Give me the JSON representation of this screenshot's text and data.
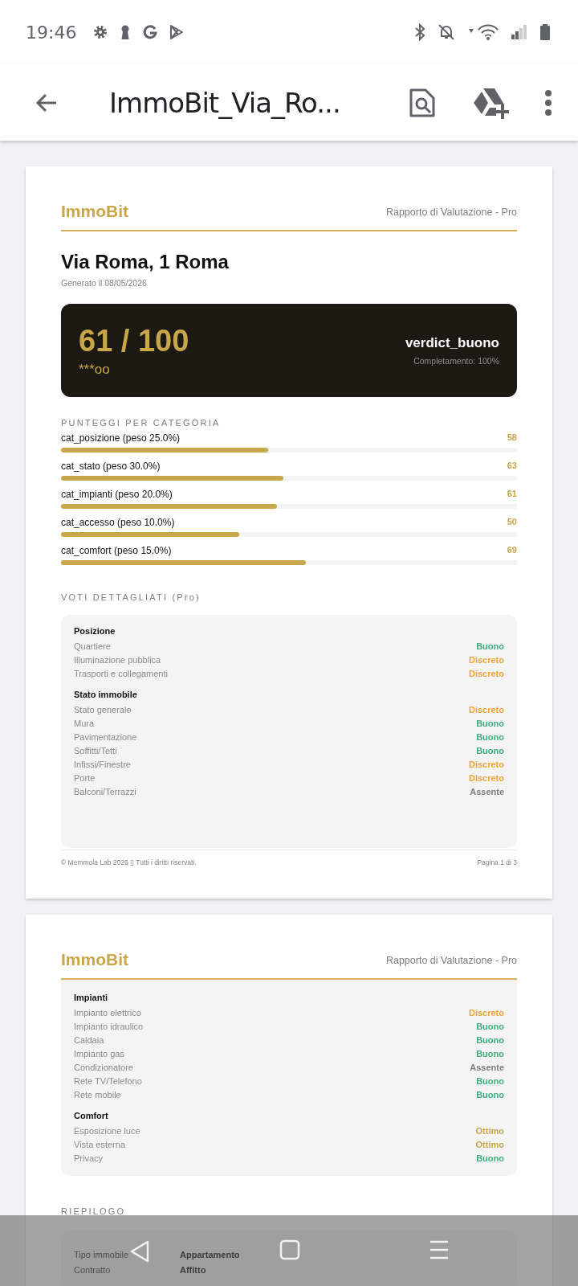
{
  "status_bar": {
    "time": "19:46"
  },
  "app_bar": {
    "title": "ImmoBit_Via_Ro..."
  },
  "pages": [
    {
      "brand": "ImmoBit",
      "report_type": "Rapporto di Valutazione - Pro",
      "address": "Via Roma, 1 Roma",
      "generated": "Generato il 08/05/2026",
      "score": {
        "value": "61 / 100",
        "stars_text": "***oo",
        "verdict": "verdict_buono",
        "completion": "Completamento: 100%"
      },
      "categories_title": "PUNTEGGI PER CATEGORIA",
      "categories": [
        {
          "label": "cat_posizione (peso 25.0%)",
          "score": "58",
          "level": 0.455
        },
        {
          "label": "cat_stato (peso 30.0%)",
          "score": "63",
          "level": 0.487
        },
        {
          "label": "cat_impianti (peso 20.0%)",
          "score": "61",
          "level": 0.473
        },
        {
          "label": "cat_accesso (peso 10.0%)",
          "score": "50",
          "level": 0.39
        },
        {
          "label": "cat_comfort (peso 15.0%)",
          "score": "69",
          "level": 0.537
        }
      ],
      "grades_title": "VOTI DETTAGLIATI (Pro)",
      "grade_groups": [
        {
          "title": "Posizione",
          "items": [
            {
              "label": "Quartiere",
              "grade": "Buono",
              "color": "#3fae7e"
            },
            {
              "label": "Illuminazione pubblica",
              "grade": "Discreto",
              "color": "#eba63a"
            },
            {
              "label": "Trasporti e collegamenti",
              "grade": "Discreto",
              "color": "#eba63a"
            }
          ]
        },
        {
          "title": "Stato immobile",
          "items": [
            {
              "label": "Stato generale",
              "grade": "Discreto",
              "color": "#eba63a"
            },
            {
              "label": "Mura",
              "grade": "Buono",
              "color": "#3fae7e"
            },
            {
              "label": "Pavimentazione",
              "grade": "Buono",
              "color": "#3fae7e"
            },
            {
              "label": "Soffitti/Tetti",
              "grade": "Buono",
              "color": "#3fae7e"
            },
            {
              "label": "Infissi/Finestre",
              "grade": "Discreto",
              "color": "#eba63a"
            },
            {
              "label": "Porte",
              "grade": "Discreto",
              "color": "#eba63a"
            },
            {
              "label": "Balconi/Terrazzi",
              "grade": "Assente",
              "color": "#7f7f7f"
            }
          ]
        }
      ],
      "footer": {
        "copyright": "© Memmola Lab 2026 ▯ Tutti i diritti riservati.",
        "page": "Pagina 1 di 3"
      }
    },
    {
      "brand": "ImmoBit",
      "report_type": "Rapporto di Valutazione - Pro",
      "grade_groups": [
        {
          "title": "Impianti",
          "items": [
            {
              "label": "Impianto elettrico",
              "grade": "Discreto",
              "color": "#eba63a"
            },
            {
              "label": "Impianto idraulico",
              "grade": "Buono",
              "color": "#3fae7e"
            },
            {
              "label": "Caldaia",
              "grade": "Buono",
              "color": "#3fae7e"
            },
            {
              "label": "Impianto gas",
              "grade": "Buono",
              "color": "#3fae7e"
            },
            {
              "label": "Condizionatore",
              "grade": "Assente",
              "color": "#7f7f7f"
            },
            {
              "label": "Rete TV/Telefono",
              "grade": "Buono",
              "color": "#3fae7e"
            },
            {
              "label": "Rete mobile",
              "grade": "Buono",
              "color": "#3fae7e"
            }
          ]
        },
        {
          "title": "Comfort",
          "items": [
            {
              "label": "Esposizione luce",
              "grade": "Ottimo",
              "color": "#c9a64a"
            },
            {
              "label": "Vista esterna",
              "grade": "Ottimo",
              "color": "#c9a64a"
            },
            {
              "label": "Privacy",
              "grade": "Buono",
              "color": "#3fae7e"
            }
          ]
        }
      ],
      "summary_title": "RIEPILOGO",
      "summary": [
        {
          "label": "Tipo immobile",
          "value": "Appartamento"
        },
        {
          "label": "Contratto",
          "value": "Affitto"
        }
      ]
    }
  ]
}
